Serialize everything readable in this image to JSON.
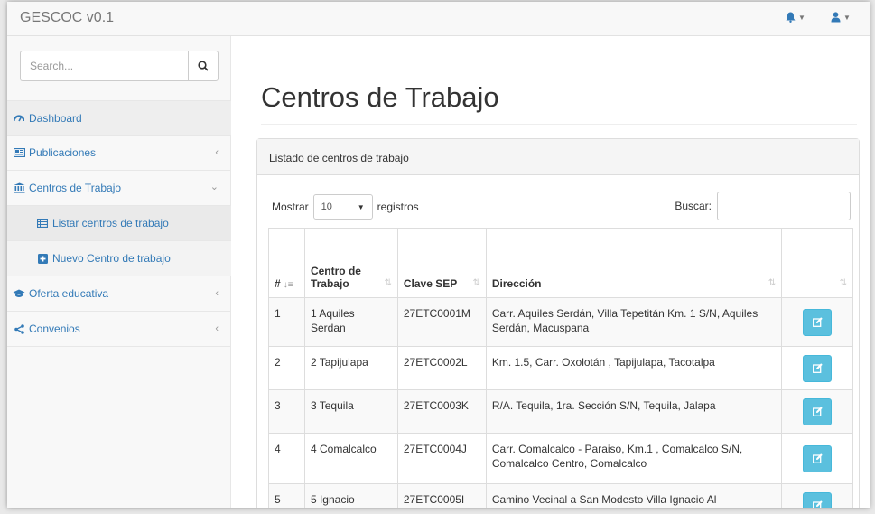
{
  "app": {
    "title": "GESCOC v0.1"
  },
  "navbar": {
    "alerts_icon": "bell-icon",
    "user_icon": "user-icon"
  },
  "sidebar": {
    "search": {
      "placeholder": "Search..."
    },
    "items": [
      {
        "label": "Dashboard",
        "icon": "dashboard-icon"
      },
      {
        "label": "Publicaciones",
        "icon": "newspaper-icon",
        "arrow": "‹"
      },
      {
        "label": "Centros de Trabajo",
        "icon": "institution-icon",
        "arrow": "⌄"
      },
      {
        "label": "Listar centros de trabajo",
        "icon": "list-icon"
      },
      {
        "label": "Nuevo Centro de trabajo",
        "icon": "plus-square-icon"
      },
      {
        "label": "Oferta educativa",
        "icon": "graduation-cap-icon",
        "arrow": "‹"
      },
      {
        "label": "Convenios",
        "icon": "share-icon",
        "arrow": "‹"
      }
    ]
  },
  "main": {
    "title": "Centros de Trabajo",
    "panel_heading": "Listado de centros de trabajo",
    "length": {
      "label_before": "Mostrar",
      "value": "10",
      "label_after": "registros"
    },
    "filter": {
      "label": "Buscar:"
    },
    "table": {
      "headers": [
        "#",
        "Centro de Trabajo",
        "Clave SEP",
        "Dirección",
        ""
      ],
      "rows": [
        {
          "num": "1",
          "centro": "1 Aquiles Serdan",
          "clave": "27ETC0001M",
          "direccion": "Carr. Aquiles Serdán, Villa Tepetitán Km. 1 S/N, Aquiles Serdán, Macuspana"
        },
        {
          "num": "2",
          "centro": "2 Tapijulapa",
          "clave": "27ETC0002L",
          "direccion": "Km. 1.5, Carr. Oxolotán , Tapijulapa, Tacotalpa"
        },
        {
          "num": "3",
          "centro": "3 Tequila",
          "clave": "27ETC0003K",
          "direccion": "R/A. Tequila, 1ra. Sección S/N, Tequila, Jalapa"
        },
        {
          "num": "4",
          "centro": "4 Comalcalco",
          "clave": "27ETC0004J",
          "direccion": "Carr. Comalcalco - Paraiso, Km.1 , Comalcalco S/N, Comalcalco Centro, Comalcalco"
        },
        {
          "num": "5",
          "centro": "5 Ignacio",
          "clave": "27ETC0005I",
          "direccion": "Camino Vecinal a San Modesto Villa Ignacio Al"
        }
      ]
    }
  },
  "colors": {
    "link": "#337ab7",
    "info_button": "#5bc0de"
  }
}
